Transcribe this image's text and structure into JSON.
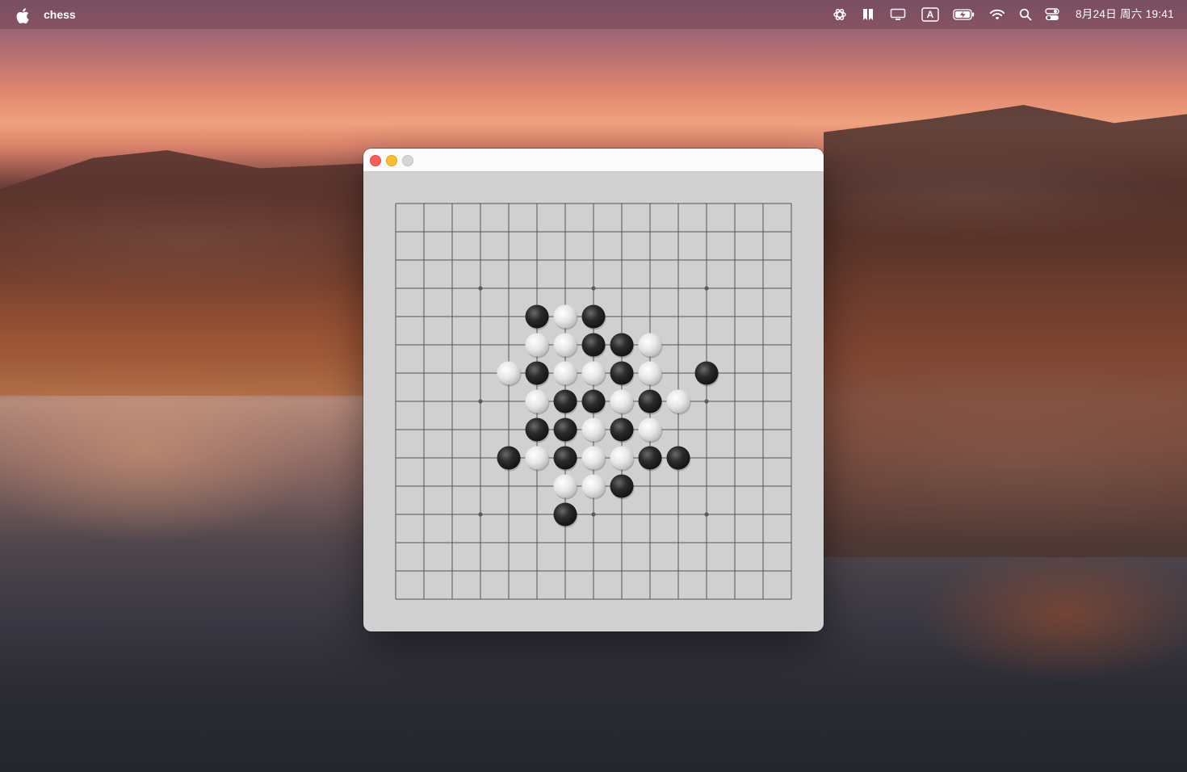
{
  "menubar": {
    "app_name": "chess",
    "clock": "8月24日 周六 19:41",
    "status_icons": [
      "chatgpt-icon",
      "bookmark-icon",
      "display-icon",
      "input-method-icon",
      "battery-icon",
      "wifi-icon",
      "spotlight-search-icon",
      "control-center-icon"
    ],
    "input_method_label": "A"
  },
  "window": {
    "title": "",
    "board": {
      "size": 15,
      "star_points": [
        [
          3,
          3
        ],
        [
          3,
          7
        ],
        [
          3,
          11
        ],
        [
          7,
          3
        ],
        [
          7,
          11
        ],
        [
          11,
          3
        ],
        [
          11,
          7
        ],
        [
          11,
          11
        ]
      ],
      "black_stones": [
        [
          4,
          5
        ],
        [
          4,
          7
        ],
        [
          5,
          7
        ],
        [
          5,
          8
        ],
        [
          6,
          5
        ],
        [
          6,
          8
        ],
        [
          6,
          11
        ],
        [
          7,
          6
        ],
        [
          7,
          7
        ],
        [
          7,
          9
        ],
        [
          8,
          5
        ],
        [
          8,
          6
        ],
        [
          8,
          8
        ],
        [
          9,
          4
        ],
        [
          9,
          6
        ],
        [
          9,
          9
        ],
        [
          9,
          10
        ],
        [
          10,
          8
        ],
        [
          11,
          6
        ]
      ],
      "white_stones": [
        [
          4,
          6
        ],
        [
          5,
          5
        ],
        [
          5,
          6
        ],
        [
          5,
          9
        ],
        [
          6,
          4
        ],
        [
          6,
          6
        ],
        [
          6,
          7
        ],
        [
          6,
          9
        ],
        [
          7,
          5
        ],
        [
          7,
          8
        ],
        [
          7,
          10
        ],
        [
          8,
          7
        ],
        [
          8,
          9
        ],
        [
          9,
          5
        ],
        [
          9,
          7
        ],
        [
          9,
          8
        ],
        [
          10,
          6
        ],
        [
          10,
          7
        ]
      ],
      "colors": {
        "board_bg": "#d0d0d0",
        "grid_line": "#555555",
        "black_stone": "#2b2b2b",
        "white_stone": "#e6e6e6"
      }
    }
  }
}
